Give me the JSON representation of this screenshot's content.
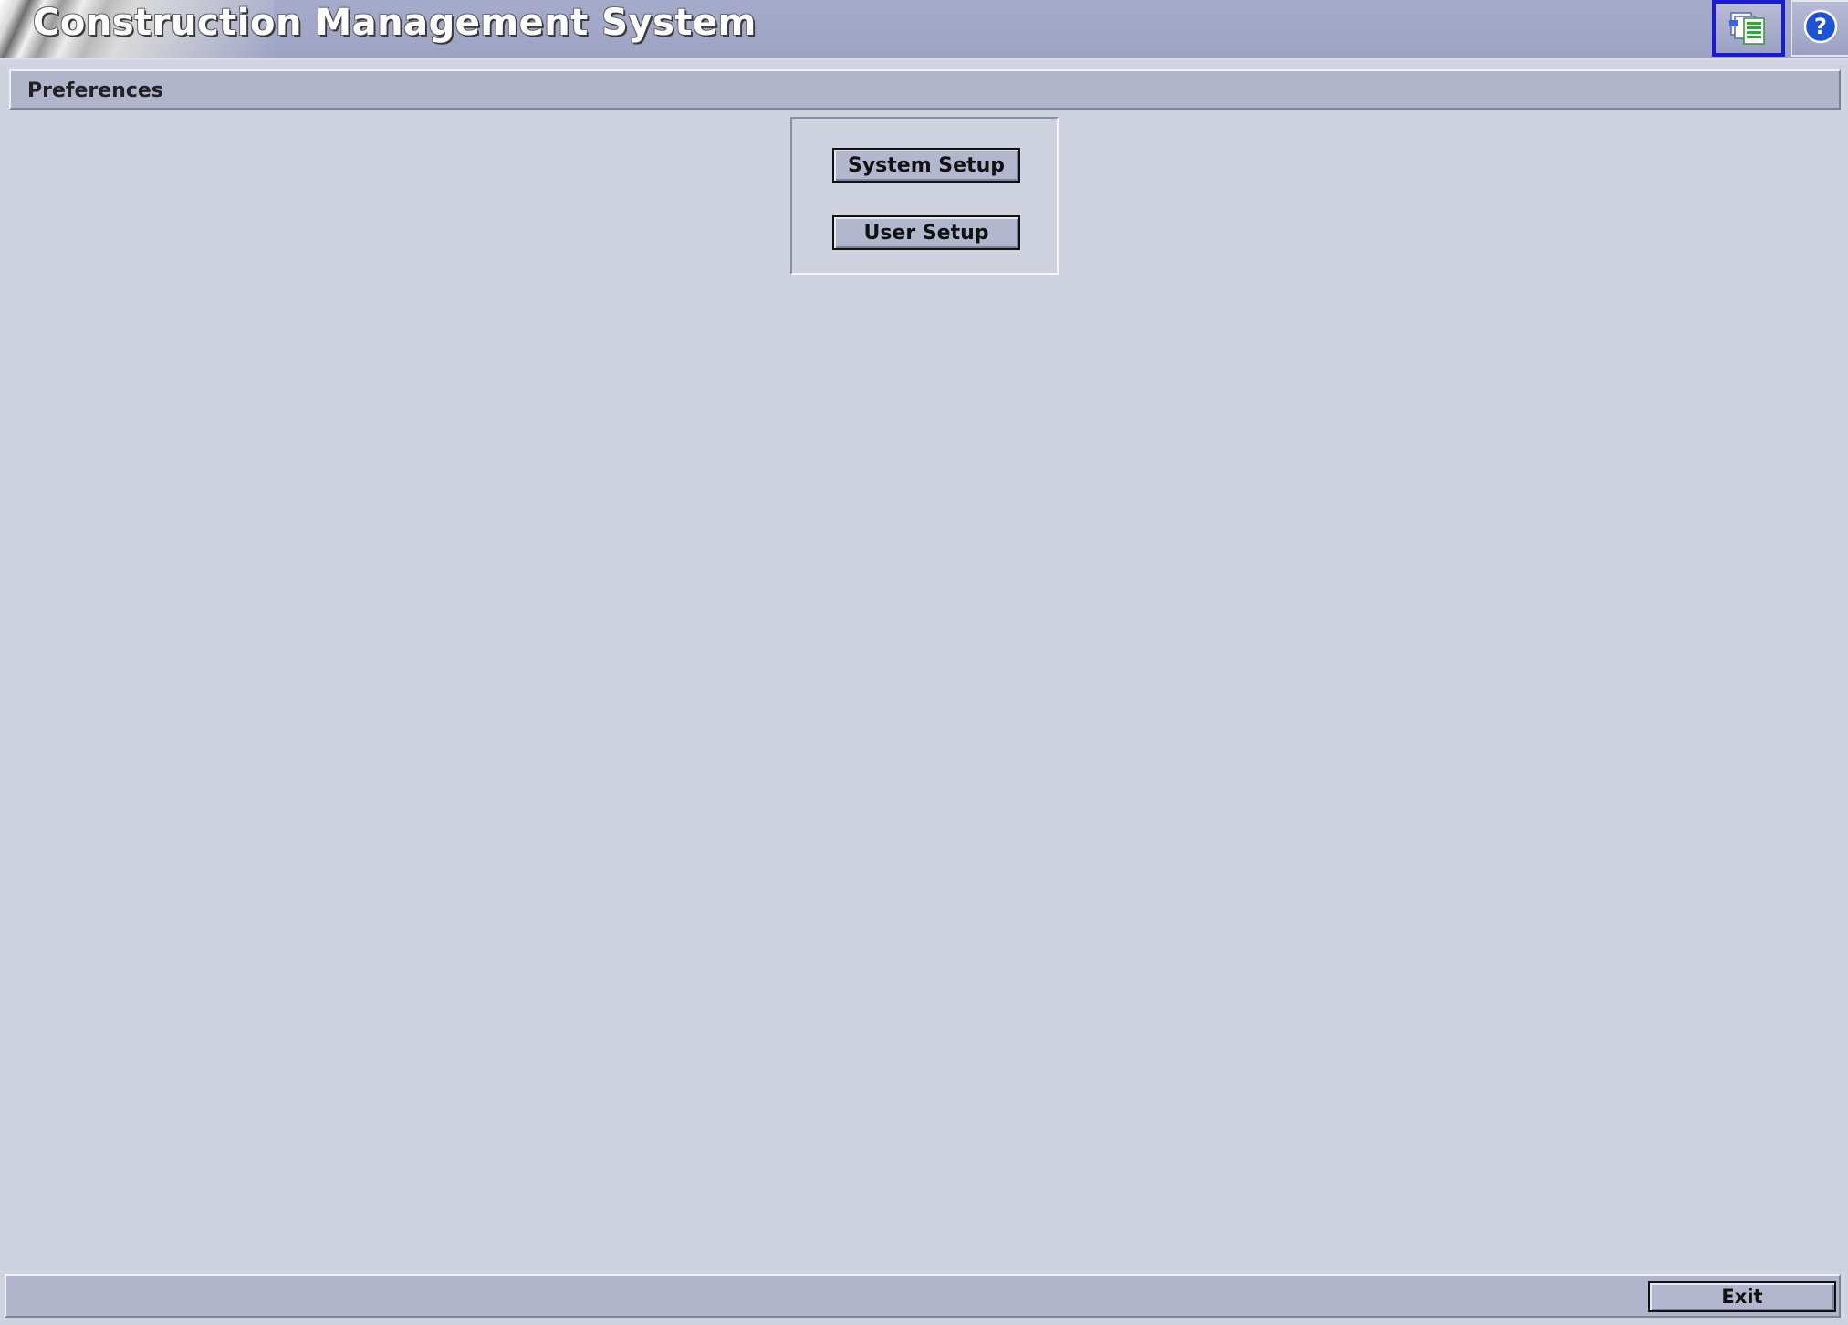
{
  "app": {
    "title": "Construction Management System"
  },
  "toolbar": {
    "documents_icon": "documents-icon",
    "help_icon": "help-icon",
    "accent_color": "#1a1ad0"
  },
  "preferences": {
    "header": "Preferences",
    "buttons": {
      "system_setup": "System Setup",
      "user_setup": "User Setup"
    }
  },
  "footer": {
    "exit_label": "Exit"
  }
}
